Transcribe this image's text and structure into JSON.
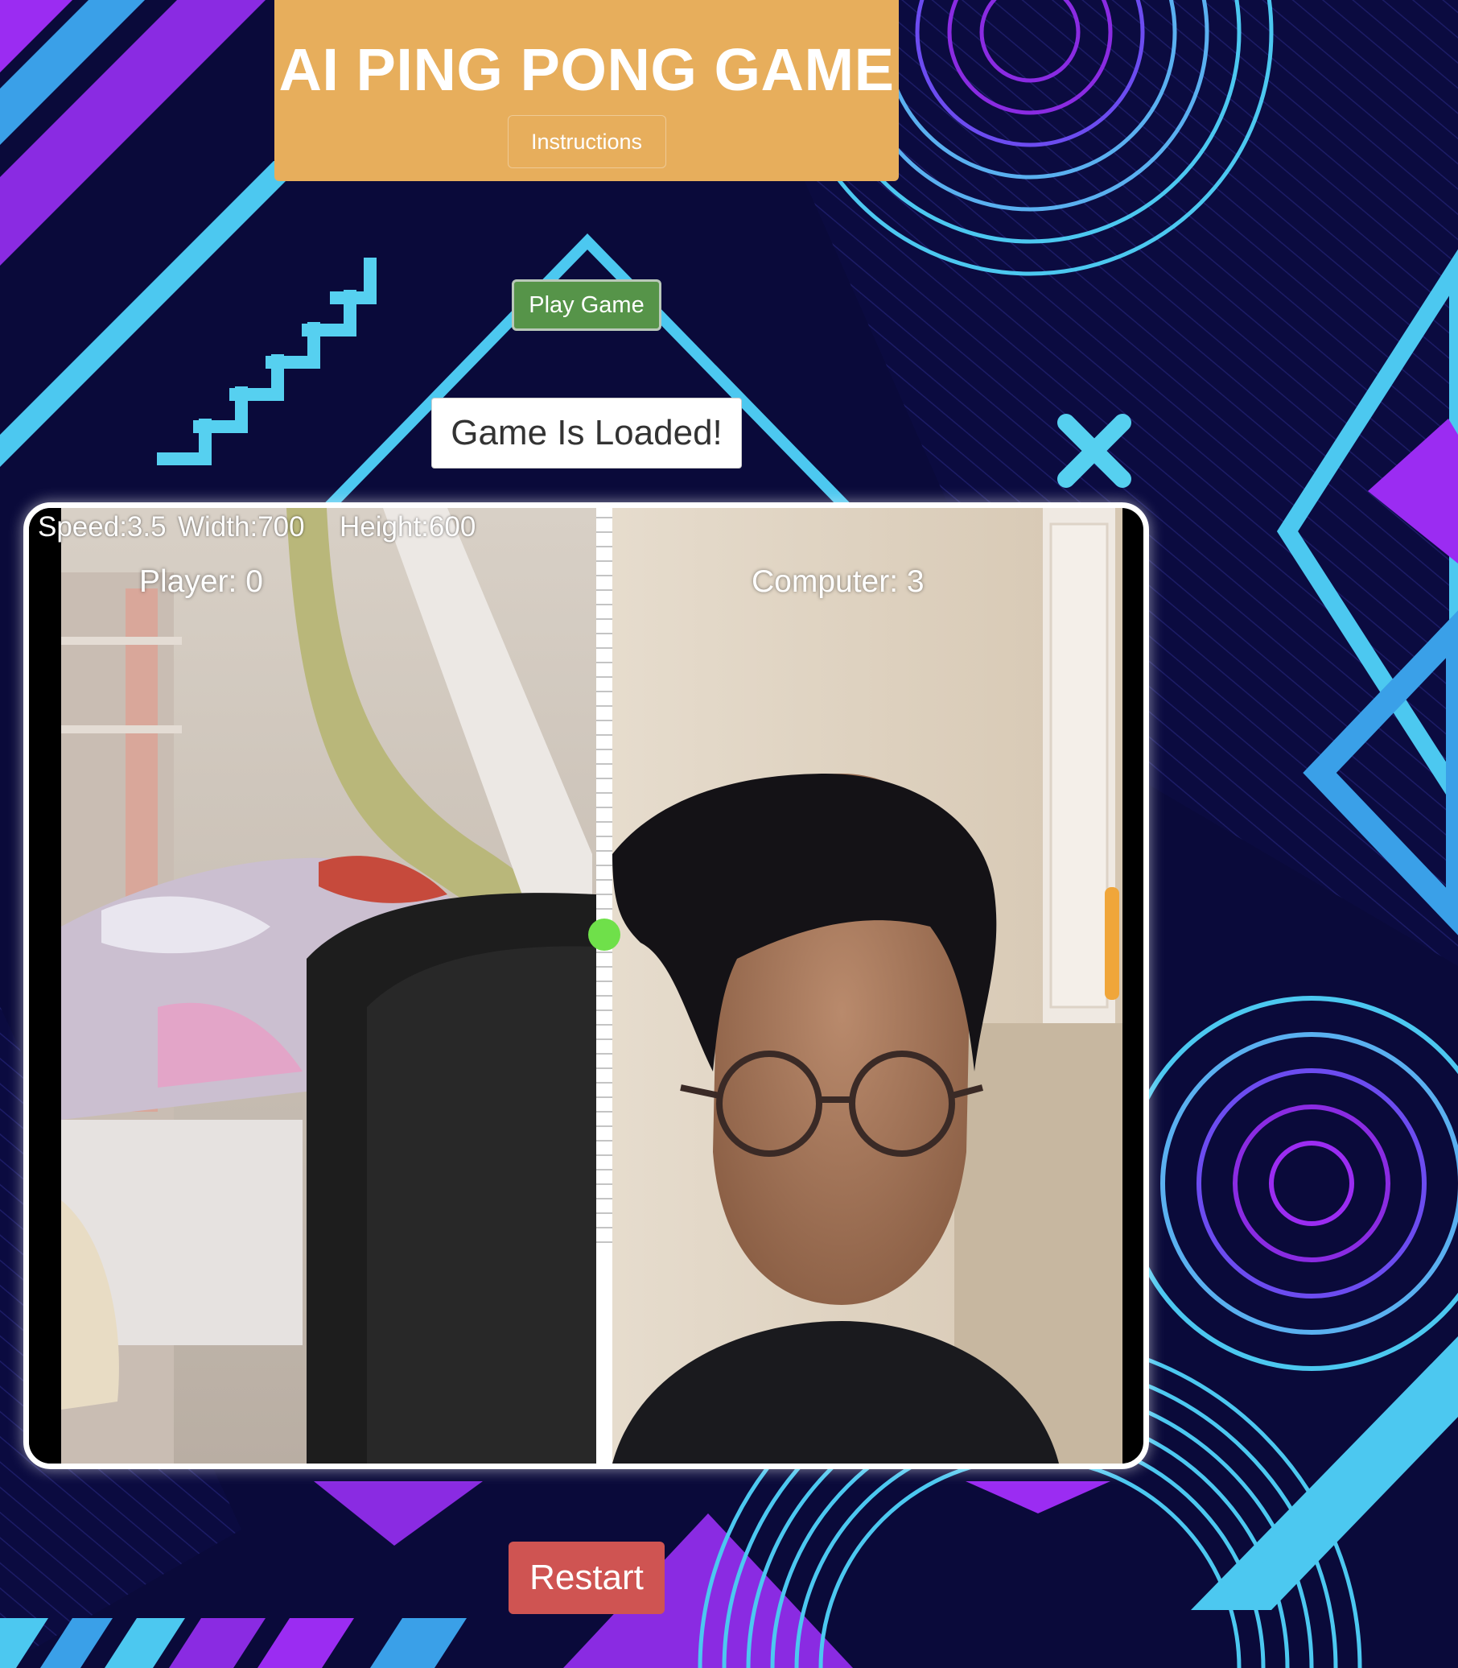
{
  "header": {
    "title": "AI PING PONG GAME",
    "instructions_label": "Instructions"
  },
  "controls": {
    "play_label": "Play Game",
    "restart_label": "Restart"
  },
  "status": {
    "message": "Game Is Loaded!"
  },
  "game": {
    "stats": {
      "speed": "Speed:3.5",
      "width": "Width:700",
      "height": "Height:600"
    },
    "scores": {
      "player": "Player: 0",
      "computer": "Computer: 3"
    },
    "ball_color": "#6fe04a",
    "paddle_color": "#f0a63a",
    "paddle_level_fraction": 0.45
  },
  "colors": {
    "header_bg": "#e7ae5c",
    "play_button": "#569449",
    "restart_button": "#cf5452",
    "background": "#0a0a3a",
    "neon_purple": "#8a2be2",
    "neon_cyan": "#4cc8f0"
  }
}
